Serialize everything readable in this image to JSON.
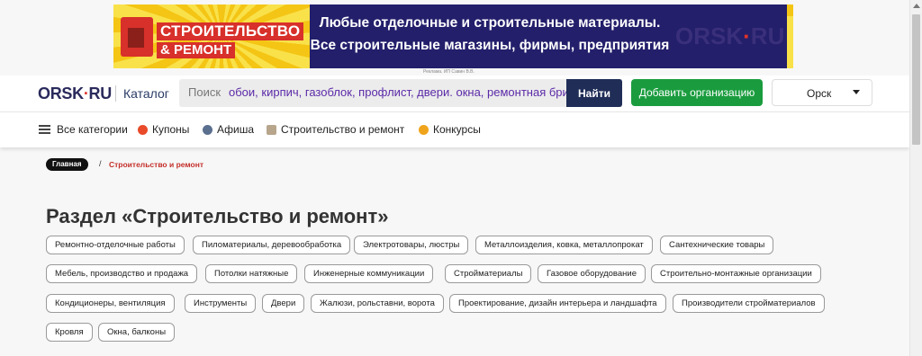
{
  "banner": {
    "left_line1": "СТРОИТЕЛЬСТВО",
    "left_line2": "& РЕМОНТ",
    "line1": "Любые отделочные и строительные материалы.",
    "line2": "Все строительные магазины, фирмы, предприятия",
    "logo_main": "ORSK",
    "logo_dot": "·",
    "logo_tail": "RU",
    "ad_note": "Реклама. ИП Савин В.В."
  },
  "header": {
    "logo_main": "ORSK",
    "logo_dot": "·",
    "logo_tail": "RU",
    "catalog": "Каталог",
    "search_placeholder": "Поиск",
    "search_hint": "обои, кирпич, газоблок, профлист, двери. окна, ремонтная бригада",
    "search_button": "Найти",
    "add_button": "Добавить организацию",
    "city": "Орск"
  },
  "nav": {
    "items": [
      {
        "label": "Все категории",
        "icon": "menu-icon"
      },
      {
        "label": "Купоны",
        "icon": "coupon-icon"
      },
      {
        "label": "Афиша",
        "icon": "globe-icon"
      },
      {
        "label": "Строительство и ремонт",
        "icon": "tools-icon"
      },
      {
        "label": "Конкурсы",
        "icon": "star-icon"
      }
    ]
  },
  "breadcrumb": {
    "home": "Главная",
    "separator": "/",
    "current": "Строительство и ремонт"
  },
  "page_title": "Раздел «Строительство и ремонт»",
  "tags": [
    "Ремонтно-отделочные работы",
    "Пиломатериалы, деревообработка",
    "Электротовары, люстры",
    "Металлоизделия, ковка, металлопрокат",
    "Сантехнические товары",
    "Мебель, производство и продажа",
    "Потолки натяжные",
    "Инженерные коммуникации",
    "Стройматериалы",
    "Газовое оборудование",
    "Строительно-монтажные организации",
    "Кондиционеры, вентиляция",
    "Инструменты",
    "Двери",
    "Жалюзи, рольставни, ворота",
    "Проектирование, дизайн интерьера и ландшафта",
    "Производители стройматериалов",
    "Кровля",
    "Окна, балконы"
  ],
  "colors": {
    "brand_navy": "#1f2d57",
    "accent_green": "#1a9c3e",
    "accent_red": "#c4302b",
    "banner_yellow": "#f4c514",
    "banner_blue": "#231f6b"
  }
}
